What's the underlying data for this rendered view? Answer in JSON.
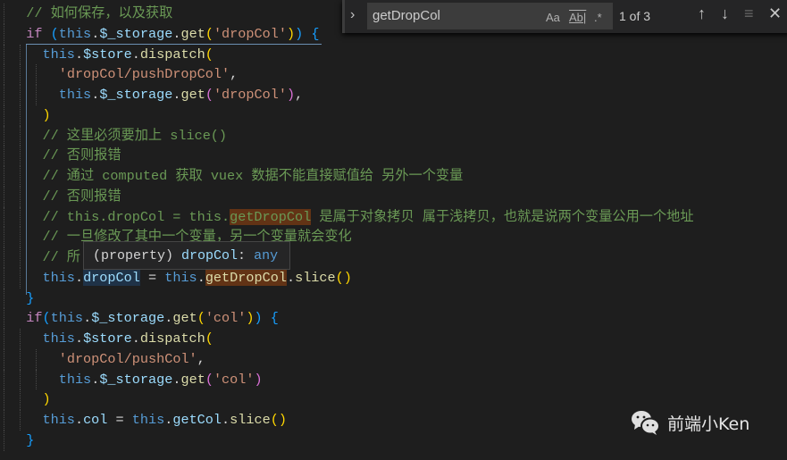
{
  "find_widget": {
    "query": "getDropCol",
    "match_case_label": "Aa",
    "whole_word_label": "Ab|",
    "regex_label": ".*",
    "result_count": "1 of 3",
    "icons": [
      "chevron-right-icon",
      "arrow-up-icon",
      "arrow-down-icon",
      "find-in-selection-icon",
      "close-icon"
    ]
  },
  "hover_tooltip": {
    "kind": "(property)",
    "name": "dropCol",
    "sep": ": ",
    "type": "any"
  },
  "watermark": {
    "text": "前端小Ken",
    "icon": "wechat-icon"
  },
  "colors": {
    "comment": "#6a9955",
    "keyword": "#c586c0",
    "this": "#569cd6",
    "property": "#9cdcfe",
    "function": "#dcdcaa",
    "string": "#ce9178",
    "match_highlight": "#623315"
  },
  "lines": [
    {
      "indent": 2,
      "tokens": [
        {
          "t": "// 如何保存，以及获取",
          "k": "comment"
        }
      ]
    },
    {
      "indent": 2,
      "tokens": [
        {
          "t": "if",
          "k": "kw"
        },
        {
          "t": " ",
          "k": "plain"
        },
        {
          "t": "(",
          "k": "b3"
        },
        {
          "t": "this",
          "k": "this"
        },
        {
          "t": ".",
          "k": "plain"
        },
        {
          "t": "$_storage",
          "k": "prop"
        },
        {
          "t": ".",
          "k": "plain"
        },
        {
          "t": "get",
          "k": "fn"
        },
        {
          "t": "(",
          "k": "b1"
        },
        {
          "t": "'dropCol'",
          "k": "str"
        },
        {
          "t": ")",
          "k": "b1"
        },
        {
          "t": ")",
          "k": "b3"
        },
        {
          "t": " ",
          "k": "plain"
        },
        {
          "t": "{",
          "k": "b3"
        }
      ]
    },
    {
      "indent": 4,
      "tokens": [
        {
          "t": "this",
          "k": "this"
        },
        {
          "t": ".",
          "k": "plain"
        },
        {
          "t": "$store",
          "k": "prop"
        },
        {
          "t": ".",
          "k": "plain"
        },
        {
          "t": "dispatch",
          "k": "fn"
        },
        {
          "t": "(",
          "k": "b1"
        }
      ]
    },
    {
      "indent": 6,
      "tokens": [
        {
          "t": "'dropCol/pushDropCol'",
          "k": "str"
        },
        {
          "t": ",",
          "k": "plain"
        }
      ]
    },
    {
      "indent": 6,
      "tokens": [
        {
          "t": "this",
          "k": "this"
        },
        {
          "t": ".",
          "k": "plain"
        },
        {
          "t": "$_storage",
          "k": "prop"
        },
        {
          "t": ".",
          "k": "plain"
        },
        {
          "t": "get",
          "k": "fn"
        },
        {
          "t": "(",
          "k": "b2"
        },
        {
          "t": "'dropCol'",
          "k": "str"
        },
        {
          "t": ")",
          "k": "b2"
        },
        {
          "t": ",",
          "k": "plain"
        }
      ]
    },
    {
      "indent": 4,
      "tokens": [
        {
          "t": ")",
          "k": "b1"
        }
      ]
    },
    {
      "indent": 4,
      "tokens": [
        {
          "t": "// 这里必须要加上 slice()",
          "k": "comment"
        }
      ]
    },
    {
      "indent": 4,
      "tokens": [
        {
          "t": "// 否则报错",
          "k": "comment"
        }
      ]
    },
    {
      "indent": 4,
      "tokens": [
        {
          "t": "// 通过 computed 获取 vuex 数据不能直接赋值给 另外一个变量",
          "k": "comment"
        }
      ]
    },
    {
      "indent": 4,
      "tokens": [
        {
          "t": "// 否则报错",
          "k": "comment"
        }
      ]
    },
    {
      "indent": 4,
      "tokens": [
        {
          "t": "// this.dropCol = this.",
          "k": "comment"
        },
        {
          "t": "getDropCol",
          "k": "comment",
          "m": 1
        },
        {
          "t": " 是属于对象拷贝 属于浅拷贝，也就是说两个变量公用一个地址",
          "k": "comment"
        }
      ]
    },
    {
      "indent": 4,
      "tokens": [
        {
          "t": "// 一旦修改了其中一个变量，另一个变量就会变化",
          "k": "comment"
        }
      ]
    },
    {
      "indent": 4,
      "tokens": [
        {
          "t": "// 所",
          "k": "comment"
        }
      ]
    },
    {
      "indent": 4,
      "tokens": [
        {
          "t": "this",
          "k": "this"
        },
        {
          "t": ".",
          "k": "plain"
        },
        {
          "t": "dropCol",
          "k": "prop",
          "s": 1
        },
        {
          "t": " = ",
          "k": "plain"
        },
        {
          "t": "this",
          "k": "this"
        },
        {
          "t": ".",
          "k": "plain"
        },
        {
          "t": "getDropCol",
          "k": "fn",
          "m": 1
        },
        {
          "t": ".",
          "k": "plain"
        },
        {
          "t": "slice",
          "k": "fn"
        },
        {
          "t": "()",
          "k": "b1"
        }
      ]
    },
    {
      "indent": 2,
      "tokens": [
        {
          "t": "}",
          "k": "b3"
        }
      ]
    },
    {
      "indent": 2,
      "tokens": [
        {
          "t": "if",
          "k": "kw"
        },
        {
          "t": "(",
          "k": "b3"
        },
        {
          "t": "this",
          "k": "this"
        },
        {
          "t": ".",
          "k": "plain"
        },
        {
          "t": "$_storage",
          "k": "prop"
        },
        {
          "t": ".",
          "k": "plain"
        },
        {
          "t": "get",
          "k": "fn"
        },
        {
          "t": "(",
          "k": "b1"
        },
        {
          "t": "'col'",
          "k": "str"
        },
        {
          "t": ")",
          "k": "b1"
        },
        {
          "t": ")",
          "k": "b3"
        },
        {
          "t": " ",
          "k": "plain"
        },
        {
          "t": "{",
          "k": "b3"
        }
      ]
    },
    {
      "indent": 4,
      "tokens": [
        {
          "t": "this",
          "k": "this"
        },
        {
          "t": ".",
          "k": "plain"
        },
        {
          "t": "$store",
          "k": "prop"
        },
        {
          "t": ".",
          "k": "plain"
        },
        {
          "t": "dispatch",
          "k": "fn"
        },
        {
          "t": "(",
          "k": "b1"
        }
      ]
    },
    {
      "indent": 6,
      "tokens": [
        {
          "t": "'dropCol/pushCol'",
          "k": "str"
        },
        {
          "t": ",",
          "k": "plain"
        }
      ]
    },
    {
      "indent": 6,
      "tokens": [
        {
          "t": "this",
          "k": "this"
        },
        {
          "t": ".",
          "k": "plain"
        },
        {
          "t": "$_storage",
          "k": "prop"
        },
        {
          "t": ".",
          "k": "plain"
        },
        {
          "t": "get",
          "k": "fn"
        },
        {
          "t": "(",
          "k": "b2"
        },
        {
          "t": "'col'",
          "k": "str"
        },
        {
          "t": ")",
          "k": "b2"
        }
      ]
    },
    {
      "indent": 4,
      "tokens": [
        {
          "t": ")",
          "k": "b1"
        }
      ]
    },
    {
      "indent": 4,
      "tokens": [
        {
          "t": "this",
          "k": "this"
        },
        {
          "t": ".",
          "k": "plain"
        },
        {
          "t": "col",
          "k": "prop"
        },
        {
          "t": " = ",
          "k": "plain"
        },
        {
          "t": "this",
          "k": "this"
        },
        {
          "t": ".",
          "k": "plain"
        },
        {
          "t": "getCol",
          "k": "prop"
        },
        {
          "t": ".",
          "k": "plain"
        },
        {
          "t": "slice",
          "k": "fn"
        },
        {
          "t": "()",
          "k": "b1"
        }
      ]
    },
    {
      "indent": 2,
      "tokens": [
        {
          "t": "}",
          "k": "b3"
        }
      ]
    }
  ]
}
